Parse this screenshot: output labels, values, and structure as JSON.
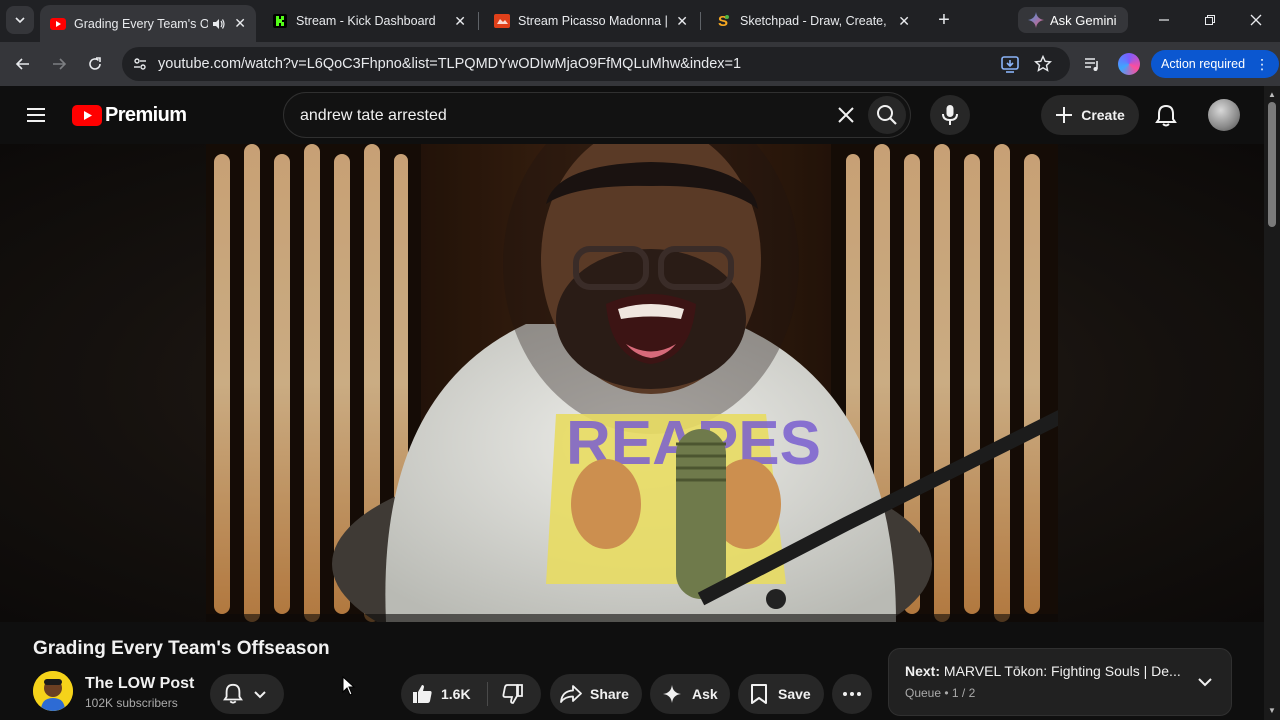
{
  "browser": {
    "tabs": [
      {
        "title": "Grading Every Team's Off",
        "active": true,
        "audio": true
      },
      {
        "title": "Stream - Kick Dashboard",
        "active": false
      },
      {
        "title": "Stream Picasso Madonna | L",
        "active": false
      },
      {
        "title": "Sketchpad - Draw, Create, Sh",
        "active": false
      }
    ],
    "ask_gemini_label": "Ask Gemini",
    "url": "youtube.com/watch?v=L6QoC3Fhpno&list=TLPQMDYwODIwMjaO9FfMQLuMhw&index=1",
    "action_required_label": "Action required"
  },
  "youtube": {
    "logo_label": "Premium",
    "search_value": "andrew tate arrested",
    "create_label": "Create"
  },
  "video": {
    "title": "Grading Every Team's Offseason",
    "channel_name": "The LOW Post",
    "subscribers": "102K subscribers",
    "likes": "1.6K",
    "share_label": "Share",
    "ask_label": "Ask",
    "save_label": "Save"
  },
  "queue": {
    "next_prefix": "Next:",
    "next_title": "MARVEL Tōkon: Fighting Souls | De...",
    "position": "Queue • 1 / 2"
  },
  "colors": {
    "accent_red": "#ff0000",
    "action_blue": "#0b57d0",
    "kick_green": "#53fc18"
  }
}
